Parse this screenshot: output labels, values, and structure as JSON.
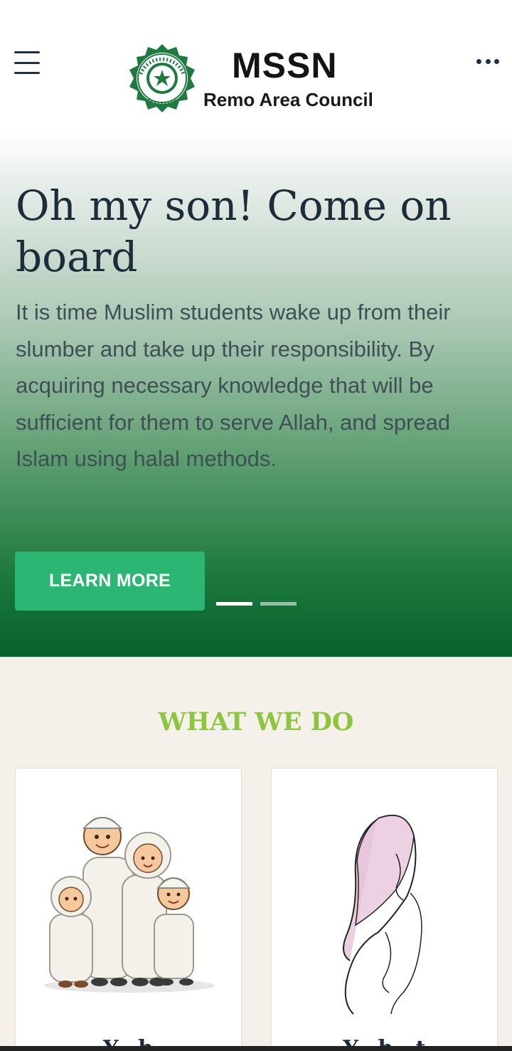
{
  "header": {
    "logo_title": "MSSN",
    "logo_subtitle": "Remo Area Council",
    "emblem_text_top": "MUSLIM STUDENTS' SOCIETY",
    "emblem_text_bottom": "NIGERIA"
  },
  "hero": {
    "title": "Oh my son! Come on board",
    "text": "It is time Muslim students wake up from their slumber and take up their responsibility. By acquiring necessary knowledge that will be sufficient for them to serve Allah, and spread Islam using halal methods.",
    "cta_label": "LEARN MORE",
    "slides_total": 2,
    "active_slide": 1
  },
  "section": {
    "title": "WHAT WE DO"
  },
  "cards": [
    {
      "title": "Y...h",
      "image": "muslim-family-illustration"
    },
    {
      "title": "Y...h...t",
      "image": "hijab-woman-line-art"
    }
  ],
  "colors": {
    "accent": "#2bb673",
    "section_title": "#8cc63f",
    "dark_text": "#1c2c3b",
    "hero_bottom": "#06612b"
  }
}
